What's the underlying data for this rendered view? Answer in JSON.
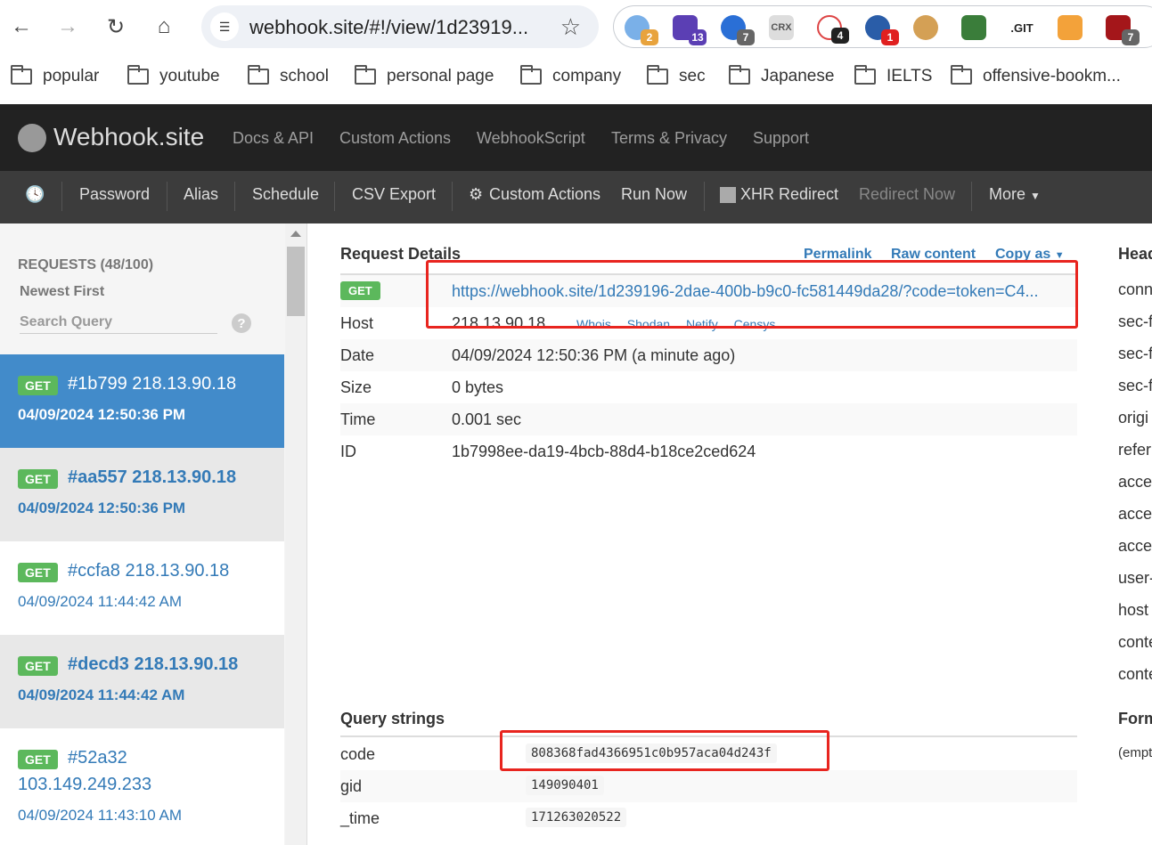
{
  "browser": {
    "url": "webhook.site/#!/view/1d23919...",
    "extensions": [
      {
        "name": "ext-1-icon",
        "badge": "2",
        "badge_color": "#e8a33d"
      },
      {
        "name": "ext-2-icon",
        "badge": "13",
        "badge_color": "#5b3fb4"
      },
      {
        "name": "ext-3-icon",
        "badge": "7",
        "badge_color": "#666666"
      },
      {
        "name": "crx-icon",
        "label": "CRX"
      },
      {
        "name": "ext-5-icon",
        "badge": "4",
        "badge_color": "#222222"
      },
      {
        "name": "ext-6-icon",
        "badge": "1",
        "badge_color": "#e02020"
      },
      {
        "name": "cookie-icon"
      },
      {
        "name": "ext-8-icon"
      },
      {
        "name": "git-icon",
        "label": ".GIT"
      },
      {
        "name": "ext-10-icon"
      },
      {
        "name": "ext-11-icon",
        "badge": "7",
        "badge_color": "#666666"
      }
    ],
    "bookmarks": [
      "popular",
      "youtube",
      "school",
      "personal page",
      "company",
      "sec",
      "Japanese",
      "IELTS",
      "offensive-bookm..."
    ]
  },
  "site": {
    "logo": "Webhook.site",
    "nav": [
      "Docs & API",
      "Custom Actions",
      "WebhookScript",
      "Terms & Privacy",
      "Support"
    ]
  },
  "toolbar": {
    "items": [
      "Password",
      "Alias",
      "Schedule",
      "CSV Export",
      "Custom Actions",
      "Run Now",
      "XHR Redirect",
      "Redirect Now",
      "More"
    ]
  },
  "sidebar": {
    "header": "REQUESTS (48/100)",
    "sort": "Newest First",
    "search_placeholder": "Search Query",
    "help": "?",
    "requests": [
      {
        "method": "GET",
        "title": "#1b799 218.13.90.18",
        "date": "04/09/2024 12:50:36 PM"
      },
      {
        "method": "GET",
        "title": "#aa557 218.13.90.18",
        "date": "04/09/2024 12:50:36 PM"
      },
      {
        "method": "GET",
        "title": "#ccfa8 218.13.90.18",
        "date": "04/09/2024 11:44:42 AM"
      },
      {
        "method": "GET",
        "title": "#decd3 218.13.90.18",
        "date": "04/09/2024 11:44:42 AM"
      },
      {
        "method": "GET",
        "title": "#52a32",
        "title2": "103.149.249.233",
        "date": "04/09/2024 11:43:10 AM"
      }
    ]
  },
  "details": {
    "title": "Request Details",
    "permalink": "Permalink",
    "raw": "Raw content",
    "copy_as": "Copy as",
    "method": "GET",
    "url": "https://webhook.site/1d239196-2dae-400b-b9c0-fc581449da28/?code=token=C4...",
    "host_label": "Host",
    "host": "218.13.90.18",
    "host_links": [
      "Whois",
      "Shodan",
      "Netify",
      "Censys"
    ],
    "date_label": "Date",
    "date": "04/09/2024 12:50:36 PM (a minute ago)",
    "size_label": "Size",
    "size": "0 bytes",
    "time_label": "Time",
    "time": "0.001 sec",
    "id_label": "ID",
    "id": "1b7998ee-da19-4bcb-88d4-b18ce2ced624"
  },
  "query": {
    "title": "Query strings",
    "rows": [
      {
        "key": "code",
        "value": "808368fad4366951c0b957aca04d243f"
      },
      {
        "key": "gid",
        "value": "149090401"
      },
      {
        "key": "_time",
        "value": "171263020522"
      }
    ]
  },
  "headers_col": {
    "title": "Head",
    "items": [
      "conn",
      "sec-f",
      "sec-f",
      "sec-f",
      "origi",
      "refer",
      "acce",
      "acce",
      "acce",
      "user-",
      "host",
      "conte",
      "conte"
    ],
    "form_title": "Form",
    "form_empty": "(empt"
  }
}
